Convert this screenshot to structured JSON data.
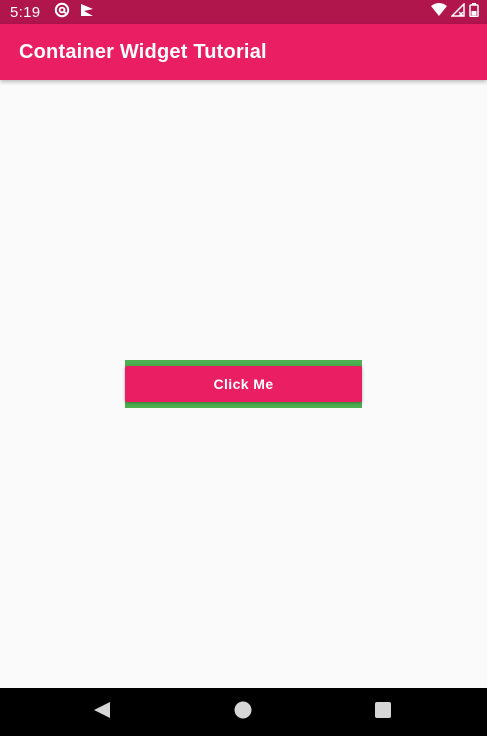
{
  "status_bar": {
    "time": "5:19",
    "left_icons": [
      "at-sign-icon",
      "flag-icon"
    ],
    "right_icons": [
      "wifi-icon",
      "signal-icon",
      "battery-icon"
    ]
  },
  "app_bar": {
    "title": "Container Widget Tutorial"
  },
  "main": {
    "button_label": "Click Me"
  },
  "nav_bar": {
    "buttons": [
      "back-icon",
      "home-icon",
      "recents-icon"
    ]
  },
  "colors": {
    "status_bar": "#b0154c",
    "primary": "#e91e63",
    "container": "#4caf50",
    "background": "#fafafa",
    "nav_bar": "#000000"
  }
}
